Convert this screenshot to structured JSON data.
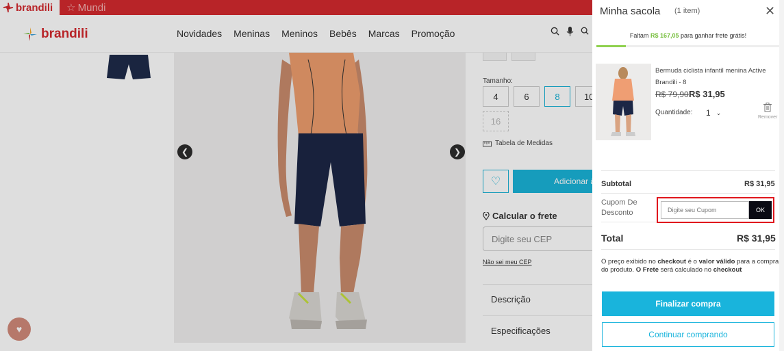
{
  "brandbar": {
    "brand1": "brandili",
    "brand2": "Mundi"
  },
  "header": {
    "logo": "brandili",
    "nav": [
      "Novidades",
      "Meninas",
      "Meninos",
      "Bebês",
      "Marcas",
      "Promoção"
    ]
  },
  "product": {
    "size_label": "Tamanho:",
    "sizes": [
      "4",
      "6",
      "8",
      "10",
      "16"
    ],
    "selected_size": "8",
    "tabela": "Tabela de Medidas",
    "add_label": "Adicionar à",
    "frete_title": "Calcular o frete",
    "cep_placeholder": "Digite seu CEP",
    "nao_sei": "Não sei meu CEP",
    "accordion": [
      "Descrição",
      "Especificações"
    ]
  },
  "cart": {
    "title": "Minha sacola",
    "count": "(1 item)",
    "progress_prefix": "Faltam",
    "progress_amount": "R$ 167,05",
    "progress_suffix": "para ganhar frete grátis!",
    "progress_fraction": 0.16,
    "item": {
      "name": "Bermuda ciclista infantil menina Active Brandili - 8",
      "old_price": "R$ 79,90",
      "price": "R$ 31,95",
      "qty_label": "Quantidade:",
      "qty": "1",
      "remove": "Remover"
    },
    "subtotal_label": "Subtotal",
    "subtotal_value": "R$ 31,95",
    "cupom_label": "Cupom De Desconto",
    "cupom_placeholder": "Digite seu Cupom",
    "cupom_ok": "OK",
    "total_label": "Total",
    "total_value": "R$ 31,95",
    "note": {
      "p1": "O preço exibido no ",
      "b1": "checkout",
      "p2": " é o ",
      "b2": "valor válido",
      "p3": " para a compra do produto. ",
      "b3": "O Frete",
      "p4": " será calculado no ",
      "b4": "checkout"
    },
    "checkout_button": "Finalizar compra",
    "continue_button": "Continuar comprando"
  },
  "colors": {
    "brand_red": "#d42a2f",
    "accent": "#19b4dc",
    "progress": "#8fd14f"
  }
}
